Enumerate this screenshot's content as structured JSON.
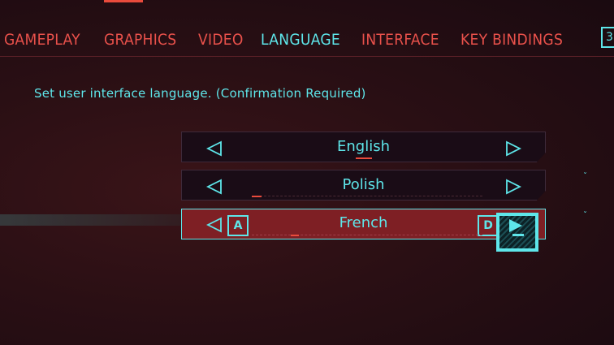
{
  "tabs": [
    {
      "label": "GAMEPLAY",
      "active": false
    },
    {
      "label": "GRAPHICS",
      "active": false
    },
    {
      "label": "VIDEO",
      "active": false
    },
    {
      "label": "LANGUAGE",
      "active": true
    },
    {
      "label": "INTERFACE",
      "active": false
    },
    {
      "label": "KEY BINDINGS",
      "active": false
    }
  ],
  "tab_extra_key": "3",
  "description": "Set user interface language. (Confirmation Required)",
  "settings": [
    {
      "value": "English",
      "progress": 0.5,
      "selected": false
    },
    {
      "value": "Polish",
      "progress": 0.05,
      "selected": false
    },
    {
      "value": "French",
      "progress": 0.2,
      "selected": true,
      "left_key": "A",
      "right_key": "D"
    }
  ],
  "colors": {
    "accent_cyan": "#5ee6ea",
    "accent_red": "#e9514b",
    "selected_row_bg": "#7e1f24",
    "row_bg": "#1a0c16",
    "background": "#2a0f14"
  },
  "icons": {
    "left_arrow": "triangle-left-outline-icon",
    "right_arrow": "triangle-right-outline-icon",
    "next": "play-next-icon"
  }
}
